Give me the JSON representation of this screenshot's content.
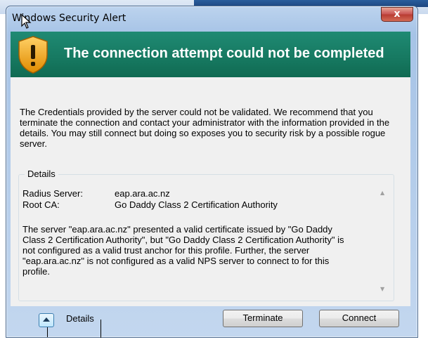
{
  "window": {
    "title": "Windows Security Alert",
    "close_label": "x"
  },
  "banner": {
    "title": "The connection attempt could not be completed"
  },
  "message": "The Credentials provided by the server could not be validated. We recommend that you terminate the connection and contact your administrator with the information provided in the details. You may still connect but doing so exposes you to security risk by a possible rogue server.",
  "details": {
    "group_label": "Details",
    "rows": [
      {
        "key": "Radius Server:",
        "value": "eap.ara.ac.nz"
      },
      {
        "key": "Root CA:",
        "value": "Go Daddy Class 2 Certification Authority"
      }
    ],
    "body": "The server \"eap.ara.ac.nz\" presented a valid certificate issued by \"Go Daddy Class 2 Certification Authority\", but \"Go Daddy Class 2 Certification Authority\" is not configured as a valid trust anchor for this profile. Further, the server \"eap.ara.ac.nz\" is not configured as a valid NPS server to connect to for this profile."
  },
  "footer": {
    "details_toggle_label": "Details",
    "terminate_label": "Terminate",
    "connect_label": "Connect"
  },
  "colors": {
    "banner": "#177a62",
    "shield": "#f5a623",
    "close": "#c75050"
  }
}
